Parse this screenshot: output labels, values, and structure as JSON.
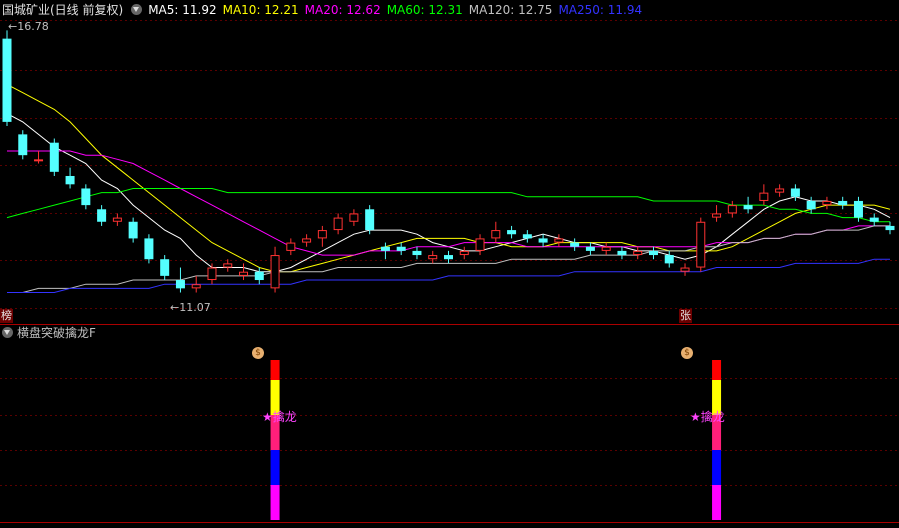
{
  "header": {
    "title": "国城矿业(日线 前复权)",
    "ma": [
      {
        "label": "MA5: 11.92",
        "color": "#ffffff"
      },
      {
        "label": "MA10: 12.21",
        "color": "#ffff00"
      },
      {
        "label": "MA20: 12.62",
        "color": "#ff00ff"
      },
      {
        "label": "MA60: 12.31",
        "color": "#00ff00"
      },
      {
        "label": "MA120: 12.75",
        "color": "#c0c0c0"
      },
      {
        "label": "MA250: 11.94",
        "color": "#3333ff"
      }
    ]
  },
  "price_labels": {
    "high": "16.78",
    "low": "11.07"
  },
  "tags": {
    "left": "榜",
    "right": "张"
  },
  "indicator": {
    "title": "横盘突破擒龙F",
    "signal_label": "★擒龙",
    "money_icon": "$"
  },
  "colors": {
    "up": "#ff3232",
    "down": "#54ffff",
    "bar_colors": [
      "#ff0000",
      "#ffff00",
      "#ff1f7a",
      "#0000ff",
      "#ff00ff"
    ]
  },
  "chart_data": {
    "type": "candlestick",
    "ylim": [
      10.2,
      17.0
    ],
    "candles": [
      [
        16.6,
        14.6,
        16.8,
        14.5
      ],
      [
        14.3,
        13.8,
        14.4,
        13.7
      ],
      [
        13.7,
        13.7,
        13.9,
        13.6
      ],
      [
        14.1,
        13.4,
        14.2,
        13.3
      ],
      [
        13.3,
        13.1,
        13.5,
        13.0
      ],
      [
        13.0,
        12.6,
        13.1,
        12.5
      ],
      [
        12.5,
        12.2,
        12.6,
        12.1
      ],
      [
        12.2,
        12.3,
        12.4,
        12.1
      ],
      [
        12.2,
        11.8,
        12.3,
        11.7
      ],
      [
        11.8,
        11.3,
        11.9,
        11.2
      ],
      [
        11.3,
        10.9,
        11.4,
        10.8
      ],
      [
        10.8,
        10.6,
        11.1,
        10.5
      ],
      [
        10.6,
        10.7,
        10.9,
        10.5
      ],
      [
        10.8,
        11.1,
        11.2,
        10.7
      ],
      [
        11.1,
        11.2,
        11.3,
        11.0
      ],
      [
        10.9,
        11.0,
        11.2,
        10.8
      ],
      [
        11.0,
        10.8,
        11.1,
        10.7
      ],
      [
        10.6,
        11.4,
        11.6,
        10.5
      ],
      [
        11.5,
        11.7,
        11.8,
        11.4
      ],
      [
        11.7,
        11.8,
        11.9,
        11.6
      ],
      [
        11.8,
        12.0,
        12.1,
        11.6
      ],
      [
        12.0,
        12.3,
        12.4,
        11.9
      ],
      [
        12.2,
        12.4,
        12.5,
        12.1
      ],
      [
        12.5,
        12.0,
        12.6,
        11.9
      ],
      [
        11.6,
        11.5,
        11.7,
        11.3
      ],
      [
        11.6,
        11.5,
        11.7,
        11.4
      ],
      [
        11.5,
        11.4,
        11.6,
        11.3
      ],
      [
        11.3,
        11.4,
        11.5,
        11.2
      ],
      [
        11.4,
        11.3,
        11.5,
        11.2
      ],
      [
        11.4,
        11.5,
        11.6,
        11.3
      ],
      [
        11.5,
        11.8,
        11.9,
        11.4
      ],
      [
        11.8,
        12.0,
        12.2,
        11.7
      ],
      [
        12.0,
        11.9,
        12.1,
        11.8
      ],
      [
        11.9,
        11.8,
        12.0,
        11.7
      ],
      [
        11.8,
        11.7,
        11.9,
        11.6
      ],
      [
        11.7,
        11.8,
        11.9,
        11.6
      ],
      [
        11.7,
        11.6,
        11.8,
        11.5
      ],
      [
        11.6,
        11.5,
        11.7,
        11.4
      ],
      [
        11.5,
        11.6,
        11.7,
        11.4
      ],
      [
        11.5,
        11.4,
        11.6,
        11.3
      ],
      [
        11.4,
        11.5,
        11.6,
        11.3
      ],
      [
        11.5,
        11.4,
        11.6,
        11.3
      ],
      [
        11.4,
        11.2,
        11.5,
        11.1
      ],
      [
        11.0,
        11.1,
        11.2,
        10.9
      ],
      [
        11.1,
        12.2,
        12.3,
        11.0
      ],
      [
        12.3,
        12.4,
        12.6,
        12.2
      ],
      [
        12.4,
        12.6,
        12.7,
        12.3
      ],
      [
        12.6,
        12.5,
        12.8,
        12.4
      ],
      [
        12.7,
        12.9,
        13.1,
        12.6
      ],
      [
        12.9,
        13.0,
        13.1,
        12.8
      ],
      [
        13.0,
        12.8,
        13.1,
        12.7
      ],
      [
        12.7,
        12.5,
        12.8,
        12.4
      ],
      [
        12.6,
        12.7,
        12.8,
        12.5
      ],
      [
        12.7,
        12.6,
        12.8,
        12.5
      ],
      [
        12.7,
        12.3,
        12.8,
        12.2
      ],
      [
        12.3,
        12.2,
        12.4,
        12.1
      ],
      [
        12.1,
        12.0,
        12.2,
        11.9
      ]
    ],
    "ma": {
      "MA5": [
        14.8,
        14.6,
        14.3,
        14.0,
        13.8,
        13.6,
        13.2,
        13.0,
        12.6,
        12.3,
        12.0,
        11.8,
        11.4,
        11.1,
        11.1,
        11.1,
        11.0,
        11.0,
        11.1,
        11.3,
        11.5,
        11.7,
        11.9,
        12.0,
        12.0,
        12.0,
        11.9,
        11.7,
        11.6,
        11.5,
        11.5,
        11.6,
        11.7,
        11.8,
        11.9,
        11.8,
        11.7,
        11.7,
        11.6,
        11.6,
        11.5,
        11.5,
        11.4,
        11.3,
        11.4,
        11.6,
        11.9,
        12.2,
        12.5,
        12.7,
        12.8,
        12.7,
        12.7,
        12.6,
        12.6,
        12.5,
        12.3
      ],
      "MA10": [
        15.5,
        15.3,
        15.1,
        14.9,
        14.6,
        14.2,
        13.8,
        13.5,
        13.2,
        12.9,
        12.6,
        12.3,
        12.0,
        11.7,
        11.5,
        11.3,
        11.1,
        11.0,
        11.0,
        11.1,
        11.2,
        11.3,
        11.4,
        11.5,
        11.6,
        11.7,
        11.8,
        11.8,
        11.8,
        11.8,
        11.7,
        11.7,
        11.6,
        11.6,
        11.6,
        11.7,
        11.7,
        11.7,
        11.7,
        11.7,
        11.6,
        11.6,
        11.5,
        11.5,
        11.5,
        11.5,
        11.6,
        11.8,
        12.0,
        12.2,
        12.4,
        12.5,
        12.6,
        12.6,
        12.6,
        12.6,
        12.5
      ],
      "MA20": [
        13.9,
        13.9,
        13.9,
        13.9,
        13.9,
        13.8,
        13.8,
        13.7,
        13.6,
        13.4,
        13.2,
        13.0,
        12.8,
        12.6,
        12.4,
        12.2,
        12.0,
        11.8,
        11.6,
        11.5,
        11.4,
        11.4,
        11.4,
        11.5,
        11.5,
        11.5,
        11.6,
        11.6,
        11.6,
        11.7,
        11.7,
        11.7,
        11.7,
        11.6,
        11.6,
        11.6,
        11.6,
        11.6,
        11.6,
        11.6,
        11.6,
        11.6,
        11.6,
        11.6,
        11.6,
        11.7,
        11.7,
        11.7,
        11.8,
        11.8,
        11.9,
        11.9,
        12.0,
        12.0,
        12.1,
        12.1,
        12.1
      ],
      "MA60": [
        12.3,
        12.4,
        12.5,
        12.6,
        12.7,
        12.8,
        12.9,
        12.9,
        13.0,
        13.0,
        13.0,
        13.0,
        13.0,
        13.0,
        12.9,
        12.9,
        12.9,
        12.9,
        12.9,
        12.9,
        12.9,
        12.9,
        12.9,
        12.9,
        12.9,
        12.9,
        12.9,
        12.9,
        12.9,
        12.9,
        12.9,
        12.9,
        12.9,
        12.8,
        12.8,
        12.8,
        12.8,
        12.8,
        12.8,
        12.8,
        12.8,
        12.7,
        12.7,
        12.7,
        12.7,
        12.7,
        12.6,
        12.6,
        12.6,
        12.5,
        12.5,
        12.4,
        12.4,
        12.3,
        12.3,
        12.2,
        12.2
      ],
      "MA120": [
        10.5,
        10.5,
        10.6,
        10.6,
        10.6,
        10.7,
        10.7,
        10.7,
        10.8,
        10.8,
        10.8,
        10.8,
        10.9,
        10.9,
        10.9,
        10.9,
        10.9,
        11.0,
        11.0,
        11.0,
        11.0,
        11.1,
        11.1,
        11.1,
        11.1,
        11.1,
        11.2,
        11.2,
        11.2,
        11.2,
        11.2,
        11.2,
        11.3,
        11.3,
        11.3,
        11.3,
        11.3,
        11.4,
        11.4,
        11.4,
        11.4,
        11.5,
        11.5,
        11.5,
        11.6,
        11.6,
        11.7,
        11.7,
        11.8,
        11.8,
        11.9,
        11.9,
        12.0,
        12.0,
        12.0,
        12.1,
        12.1
      ],
      "MA250": [
        10.5,
        10.5,
        10.5,
        10.5,
        10.6,
        10.6,
        10.6,
        10.6,
        10.6,
        10.6,
        10.7,
        10.7,
        10.7,
        10.7,
        10.7,
        10.7,
        10.7,
        10.7,
        10.7,
        10.8,
        10.8,
        10.8,
        10.8,
        10.8,
        10.8,
        10.8,
        10.8,
        10.8,
        10.9,
        10.9,
        10.9,
        10.9,
        10.9,
        10.9,
        10.9,
        10.9,
        11.0,
        11.0,
        11.0,
        11.0,
        11.0,
        11.0,
        11.0,
        11.0,
        11.0,
        11.1,
        11.1,
        11.1,
        11.1,
        11.1,
        11.2,
        11.2,
        11.2,
        11.2,
        11.2,
        11.3,
        11.3
      ]
    },
    "signals": [
      17,
      45
    ]
  }
}
